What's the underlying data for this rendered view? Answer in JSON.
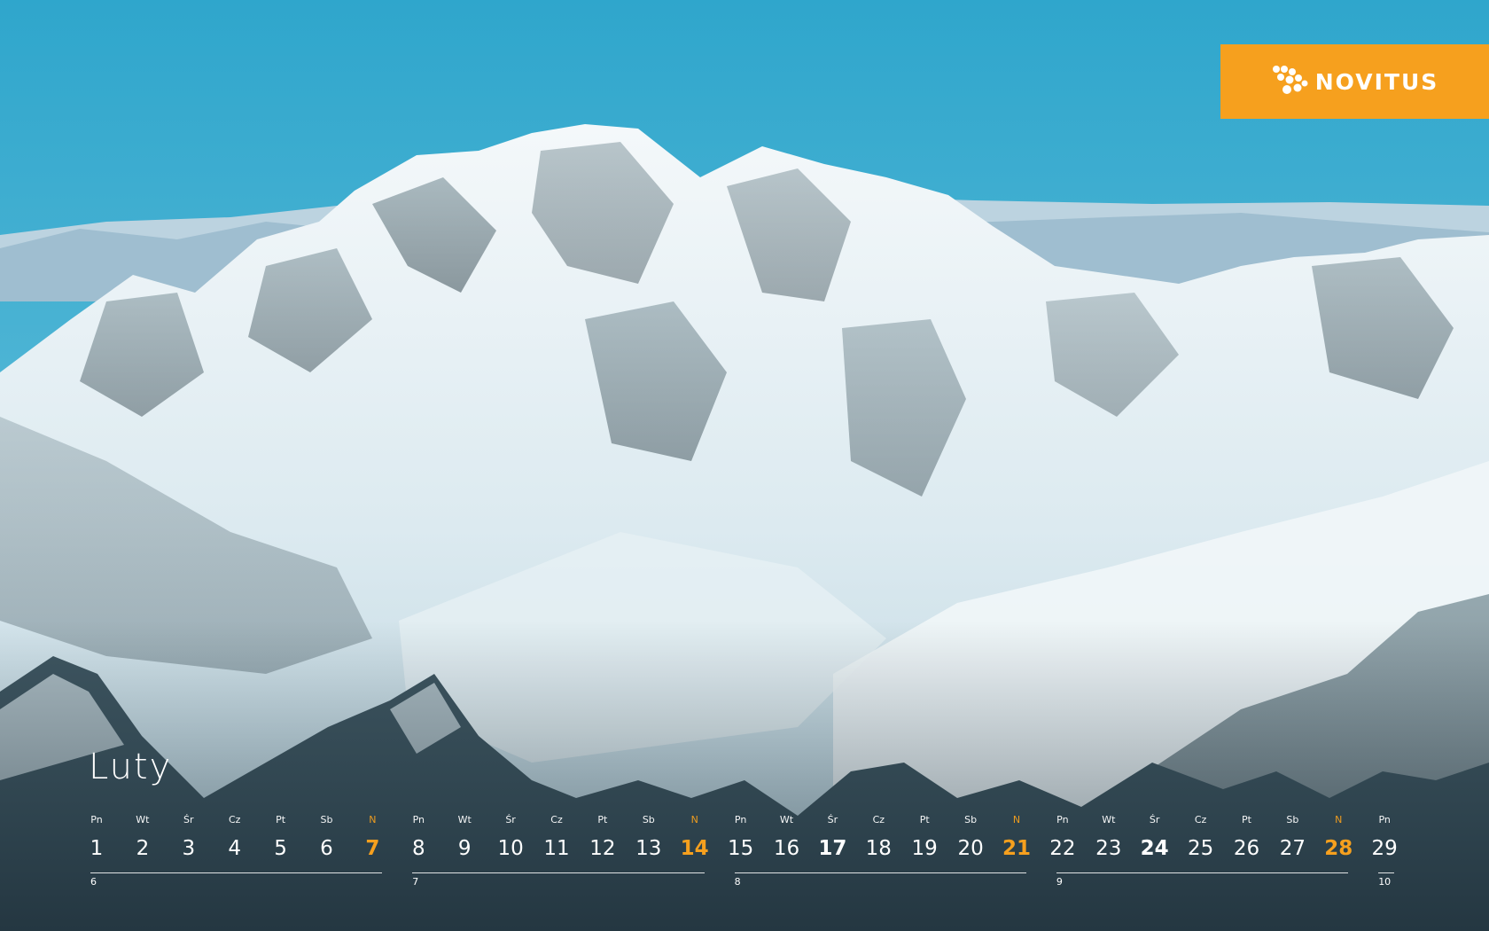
{
  "brand": {
    "name": "NOVITUS",
    "color": "#F6A01E"
  },
  "calendar": {
    "month": "Luty",
    "days": [
      {
        "dn": "Pn",
        "n": "1"
      },
      {
        "dn": "Wt",
        "n": "2"
      },
      {
        "dn": "Śr",
        "n": "3"
      },
      {
        "dn": "Cz",
        "n": "4"
      },
      {
        "dn": "Pt",
        "n": "5"
      },
      {
        "dn": "Sb",
        "n": "6"
      },
      {
        "dn": "N",
        "n": "7",
        "sun": true
      },
      {
        "dn": "Pn",
        "n": "8"
      },
      {
        "dn": "Wt",
        "n": "9"
      },
      {
        "dn": "Śr",
        "n": "10"
      },
      {
        "dn": "Cz",
        "n": "11"
      },
      {
        "dn": "Pt",
        "n": "12"
      },
      {
        "dn": "Sb",
        "n": "13"
      },
      {
        "dn": "N",
        "n": "14",
        "sun": true
      },
      {
        "dn": "Pn",
        "n": "15"
      },
      {
        "dn": "Wt",
        "n": "16"
      },
      {
        "dn": "Śr",
        "n": "17",
        "bold": true
      },
      {
        "dn": "Cz",
        "n": "18"
      },
      {
        "dn": "Pt",
        "n": "19"
      },
      {
        "dn": "Sb",
        "n": "20"
      },
      {
        "dn": "N",
        "n": "21",
        "sun": true
      },
      {
        "dn": "Pn",
        "n": "22"
      },
      {
        "dn": "Wt",
        "n": "23"
      },
      {
        "dn": "Śr",
        "n": "24",
        "bold": true
      },
      {
        "dn": "Cz",
        "n": "25"
      },
      {
        "dn": "Pt",
        "n": "26"
      },
      {
        "dn": "Sb",
        "n": "27"
      },
      {
        "dn": "N",
        "n": "28",
        "sun": true
      },
      {
        "dn": "Pn",
        "n": "29"
      }
    ],
    "weeks": [
      "6",
      "7",
      "8",
      "9",
      "10"
    ]
  }
}
